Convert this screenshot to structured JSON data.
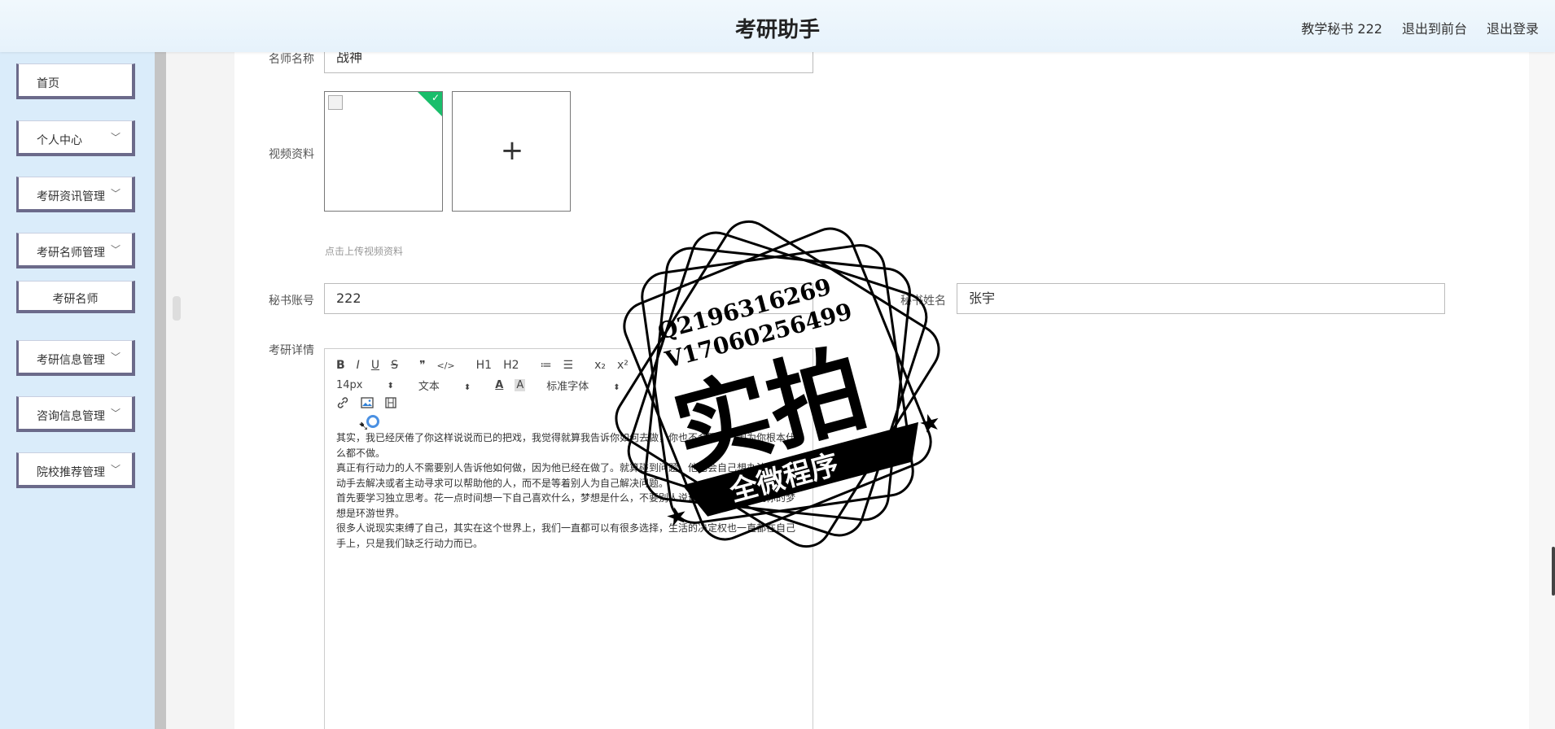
{
  "app": {
    "title": "考研助手"
  },
  "header_user": {
    "username": "教学秘书 222",
    "back_front": "退出到前台",
    "logout": "退出登录"
  },
  "sidebar": {
    "items": [
      {
        "label": "首页",
        "chevron": ""
      },
      {
        "label": "个人中心",
        "chevron": "﹀"
      },
      {
        "label": "考研资讯管理",
        "chevron": "﹀"
      },
      {
        "label": "考研名师管理",
        "chevron": "﹀"
      },
      {
        "label": "考研名师",
        "chevron": ""
      },
      {
        "label": "考研信息管理",
        "chevron": "﹀"
      },
      {
        "label": "咨询信息管理",
        "chevron": "﹀"
      },
      {
        "label": "院校推荐管理",
        "chevron": "﹀"
      }
    ]
  },
  "form": {
    "teacher_name": {
      "label": "名师名称",
      "value": "战神"
    },
    "video": {
      "label": "视频资料",
      "hint": "点击上传视频资料",
      "plus": "+"
    },
    "secretary_account": {
      "label": "秘书账号",
      "value": "222"
    },
    "secretary_name": {
      "label": "秘书姓名",
      "value": "张宇"
    },
    "details": {
      "label": "考研详情"
    }
  },
  "editor": {
    "toolbar_row1": [
      "B",
      "I",
      "U",
      "S",
      "❞",
      "</>",
      "H1",
      "H2",
      "≔",
      "☰",
      "x₂",
      "x²"
    ],
    "font_size": "14px",
    "block_type": "文本",
    "font_color_icon": "A",
    "bg_color_icon": "A",
    "font_family": "标准字体",
    "toolbar_row3": [
      "link-icon",
      "image-icon",
      "video-icon"
    ],
    "paragraphs": [
      "其实，我已经厌倦了你这样说说而已的把戏，我觉得就算我告诉你如何去做，你也不会照做，因为你根本什么都不做。",
      "真正有行动力的人不需要别人告诉他如何做，因为他已经在做了。就算碰到问题，他也会自己想办法，自己动手去解决或者主动寻求可以帮助他的人，而不是等着别人为自己解决问题。",
      "首先要学习独立思考。花一点时间想一下自己喜欢什么，梦想是什么，不要别人说环游世界，你就说你的梦想是环游世界。",
      "很多人说现实束缚了自己，其实在这个世界上，我们一直都可以有很多选择，生活的决定权也一直都在自己手上，只是我们缺乏行动力而已。"
    ]
  },
  "watermark": {
    "qq": "Q2196316269",
    "vx": "V17060256499",
    "main": "实拍",
    "banner": "全微程序"
  }
}
